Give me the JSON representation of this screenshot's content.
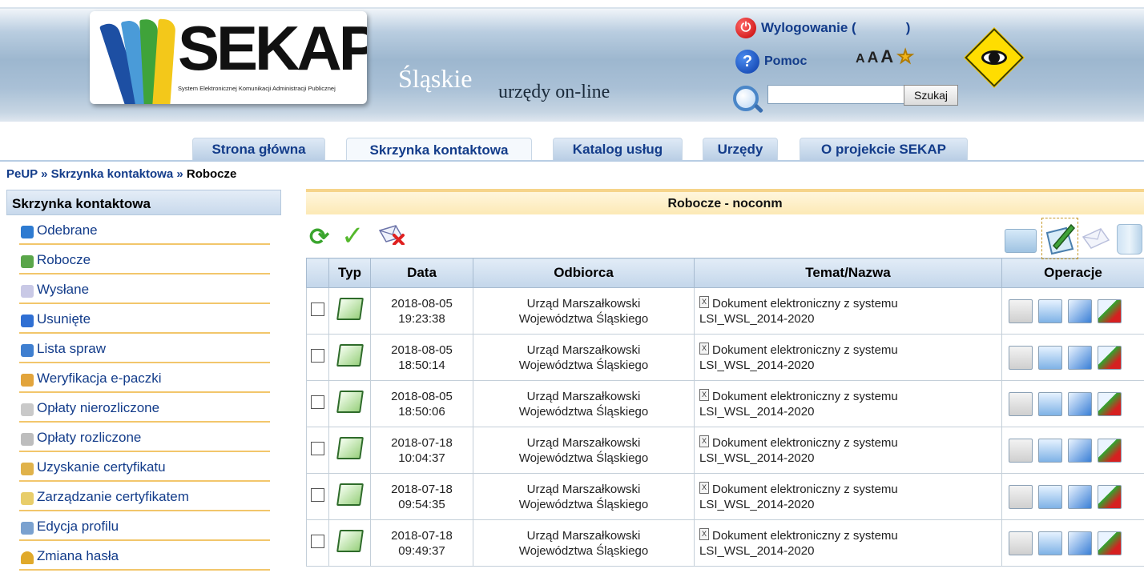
{
  "header": {
    "logo_text": "SEKAP",
    "logo_subtitle": "System Elektronicznej Komunikacji Administracji Publicznej",
    "region": "Śląskie",
    "tagline": "urzędy on-line",
    "logout_label": "Wylogowanie (",
    "logout_close": ")",
    "help_label": "Pomoc",
    "font_sizes": [
      "A",
      "A",
      "A"
    ],
    "search": {
      "value": "",
      "button": "Szukaj"
    }
  },
  "tabs": [
    {
      "label": "Strona główna",
      "active": false
    },
    {
      "label": "Skrzynka kontaktowa",
      "active": true
    },
    {
      "label": "Katalog usług",
      "active": false
    },
    {
      "label": "Urzędy",
      "active": false
    },
    {
      "label": "O projekcie SEKAP",
      "active": false
    }
  ],
  "breadcrumb": {
    "part1": "PeUP",
    "sep": "»",
    "part2": "Skrzynka kontaktowa",
    "current": "Robocze"
  },
  "sidebar": {
    "title": "Skrzynka kontaktowa",
    "items": [
      {
        "label": "Odebrane",
        "icon": "inbox-icon",
        "color": "#2e7bd1"
      },
      {
        "label": "Robocze",
        "icon": "draft-icon",
        "color": "#5aa64a"
      },
      {
        "label": "Wysłane",
        "icon": "envelope-icon",
        "color": "#c9c9e6"
      },
      {
        "label": "Usunięte",
        "icon": "trash-icon",
        "color": "#2f6fd3"
      },
      {
        "label": "Lista spraw",
        "icon": "folder-icon",
        "color": "#3f7fd0"
      },
      {
        "label": "Weryfikacja e-paczki",
        "icon": "package-icon",
        "color": "#e2a43b"
      },
      {
        "label": "Opłaty nierozliczone",
        "icon": "payment-icon",
        "color": "#c9c9c9"
      },
      {
        "label": "Opłaty rozliczone",
        "icon": "payment-done-icon",
        "color": "#bdbdbd"
      },
      {
        "label": "Uzyskanie certyfikatu",
        "icon": "certificate-icon",
        "color": "#e0b24a"
      },
      {
        "label": "Zarządzanie certyfikatem",
        "icon": "certificate-manage-icon",
        "color": "#e8cd6a"
      },
      {
        "label": "Edycja profilu",
        "icon": "profile-icon",
        "color": "#7aa1cf"
      },
      {
        "label": "Zmiana hasła",
        "icon": "key-icon",
        "color": "#e0a92a"
      }
    ]
  },
  "main": {
    "title": "Robocze - noconm",
    "columns": [
      "Typ",
      "Data",
      "Odbiorca",
      "Temat/Nazwa",
      "Operacje"
    ],
    "rows": [
      {
        "date": "2018-08-05",
        "time": "19:23:38",
        "recipient1": "Urząd Marszałkowski",
        "recipient2": "Województwa Śląskiego",
        "subject1": "Dokument elektroniczny z systemu",
        "subject2": "LSI_WSL_2014-2020"
      },
      {
        "date": "2018-08-05",
        "time": "18:50:14",
        "recipient1": "Urząd Marszałkowski",
        "recipient2": "Województwa Śląskiego",
        "subject1": "Dokument elektroniczny z systemu",
        "subject2": "LSI_WSL_2014-2020"
      },
      {
        "date": "2018-08-05",
        "time": "18:50:06",
        "recipient1": "Urząd Marszałkowski",
        "recipient2": "Województwa Śląskiego",
        "subject1": "Dokument elektroniczny z systemu",
        "subject2": "LSI_WSL_2014-2020"
      },
      {
        "date": "2018-07-18",
        "time": "10:04:37",
        "recipient1": "Urząd Marszałkowski",
        "recipient2": "Województwa Śląskiego",
        "subject1": "Dokument elektroniczny z systemu",
        "subject2": "LSI_WSL_2014-2020"
      },
      {
        "date": "2018-07-18",
        "time": "09:54:35",
        "recipient1": "Urząd Marszałkowski",
        "recipient2": "Województwa Śląskiego",
        "subject1": "Dokument elektroniczny z systemu",
        "subject2": "LSI_WSL_2014-2020"
      },
      {
        "date": "2018-07-18",
        "time": "09:49:37",
        "recipient1": "Urząd Marszałkowski",
        "recipient2": "Województwa Śląskiego",
        "subject1": "Dokument elektroniczny z systemu",
        "subject2": "LSI_WSL_2014-2020"
      }
    ]
  },
  "colors": {
    "link": "#133c8a",
    "accent": "#f6d48a",
    "header_blue": "#9db7cf"
  }
}
